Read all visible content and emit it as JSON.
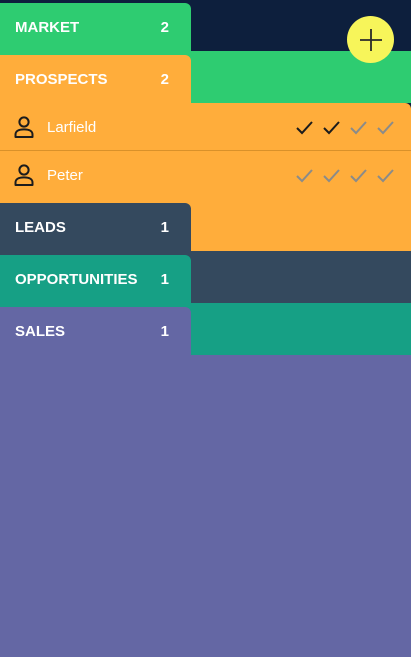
{
  "colors": {
    "navy": "#0d1f3d",
    "market": "#2ecc71",
    "prospects": "#ffad3b",
    "leads": "#34495e",
    "opportunities": "#16a085",
    "sales": "#6467a4",
    "fab": "#f7f55a",
    "check_done": "#1c1c1c",
    "check_pending": "#8a8b8a",
    "row_divider": "#d9912a"
  },
  "fab": {
    "icon": "plus-icon"
  },
  "pipeline": [
    {
      "key": "market",
      "label": "MARKET",
      "count": "2"
    },
    {
      "key": "prospects",
      "label": "PROSPECTS",
      "count": "2"
    },
    {
      "key": "leads",
      "label": "LEADS",
      "count": "1"
    },
    {
      "key": "opportunities",
      "label": "OPPORTUNITIES",
      "count": "1"
    },
    {
      "key": "sales",
      "label": "SALES",
      "count": "1"
    }
  ],
  "prospects": [
    {
      "name": "Larfield",
      "icon": "person-icon",
      "steps_completed": 2,
      "steps_total": 4
    },
    {
      "name": "Peter",
      "icon": "person-icon",
      "steps_completed": 0,
      "steps_total": 4
    }
  ]
}
